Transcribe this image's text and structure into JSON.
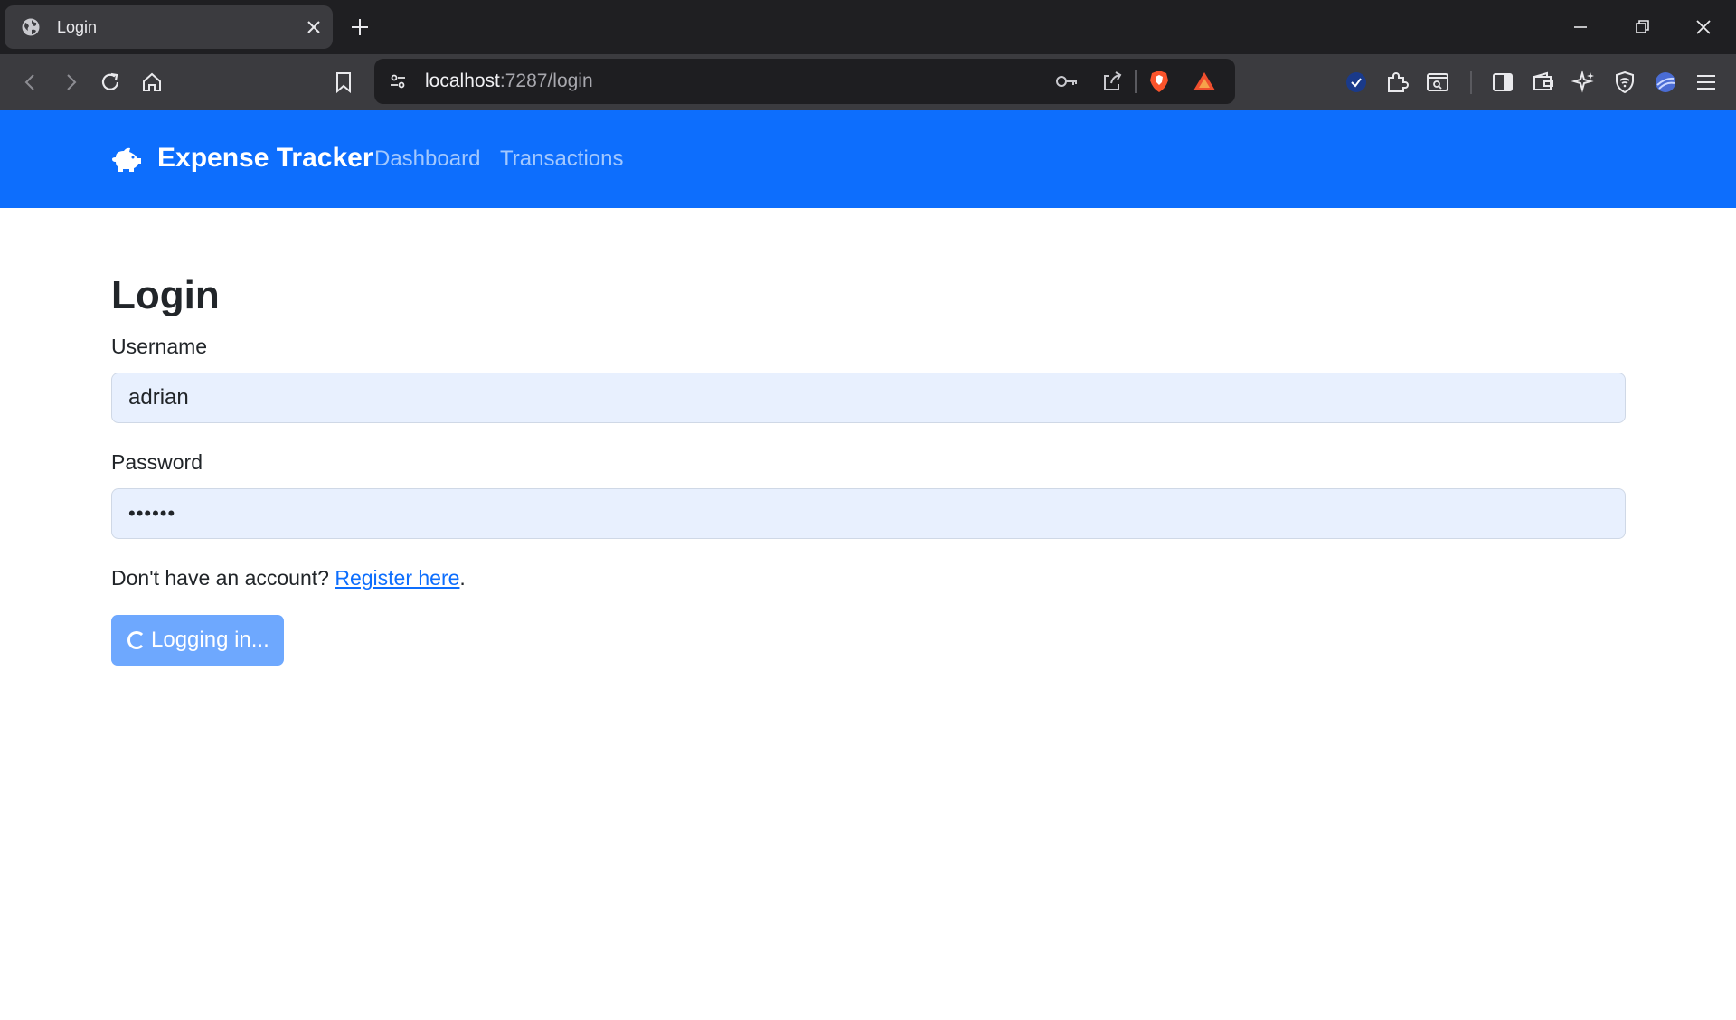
{
  "browser": {
    "tab_title": "Login",
    "url_host": "localhost",
    "url_rest": ":7287/login"
  },
  "navbar": {
    "brand": "Expense Tracker",
    "links": [
      "Dashboard",
      "Transactions"
    ]
  },
  "login": {
    "heading": "Login",
    "username_label": "Username",
    "username_value": "adrian",
    "password_label": "Password",
    "password_value": "••••••",
    "hint_text": "Don't have an account? ",
    "register_link": "Register here",
    "hint_end": ".",
    "submit_label": "Logging in..."
  },
  "colors": {
    "navbar": "#0d6efd",
    "button_disabled": "#6ea8fe",
    "input_autofill": "#e8f0fe",
    "link": "#0d6efd"
  },
  "icons": {
    "tab": "globe-icon",
    "brand": "piggy-bank-icon",
    "spinner": "loading-spinner-icon"
  }
}
